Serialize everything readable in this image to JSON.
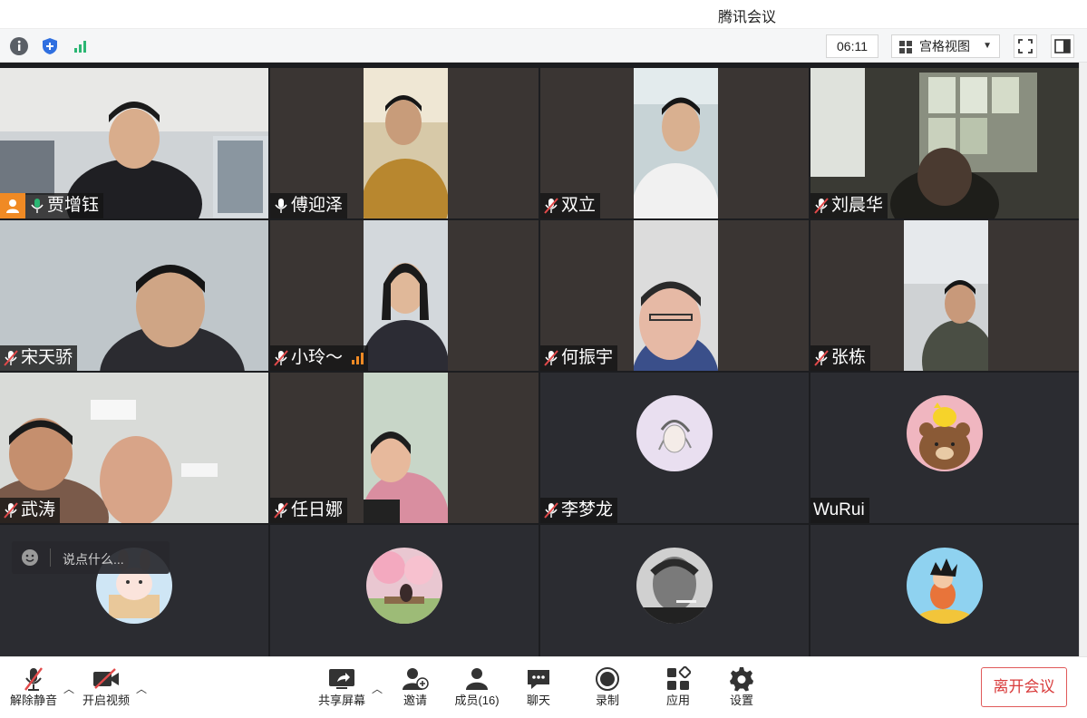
{
  "window": {
    "title": "腾讯会议"
  },
  "toolbar": {
    "timer": "06:11",
    "view_mode": "宫格视图"
  },
  "participants": [
    {
      "name": "贾增钰",
      "mic": "on",
      "host": true,
      "kind": "video"
    },
    {
      "name": "傅迎泽",
      "mic": "on-white",
      "kind": "video"
    },
    {
      "name": "双立",
      "mic": "muted",
      "kind": "video"
    },
    {
      "name": "刘晨华",
      "mic": "muted",
      "kind": "video"
    },
    {
      "name": "宋天骄",
      "mic": "muted",
      "kind": "video"
    },
    {
      "name": "小玲～",
      "mic": "muted",
      "kind": "video",
      "signal": true
    },
    {
      "name": "何振宇",
      "mic": "muted",
      "kind": "video"
    },
    {
      "name": "张栋",
      "mic": "muted",
      "kind": "video"
    },
    {
      "name": "武涛",
      "mic": "muted",
      "kind": "video"
    },
    {
      "name": "任日娜",
      "mic": "muted",
      "kind": "video"
    },
    {
      "name": "李梦龙",
      "mic": "muted",
      "kind": "avatar"
    },
    {
      "name": "WuRui",
      "mic": "none",
      "kind": "avatar"
    },
    {
      "name": "",
      "kind": "avatar"
    },
    {
      "name": "",
      "kind": "avatar"
    },
    {
      "name": "",
      "kind": "avatar"
    },
    {
      "name": "",
      "kind": "avatar"
    }
  ],
  "chat_input": {
    "placeholder": "说点什么..."
  },
  "bottom": {
    "unmute": "解除静音",
    "start_video": "开启视频",
    "share_screen": "共享屏幕",
    "invite": "邀请",
    "members": "成员(16)",
    "chat": "聊天",
    "record": "录制",
    "apps": "应用",
    "settings": "设置",
    "leave": "离开会议"
  },
  "colors": {
    "accent": "#2bb673",
    "host": "#f08a24",
    "leave": "#d93c3c",
    "muted": "#e24a4a"
  }
}
